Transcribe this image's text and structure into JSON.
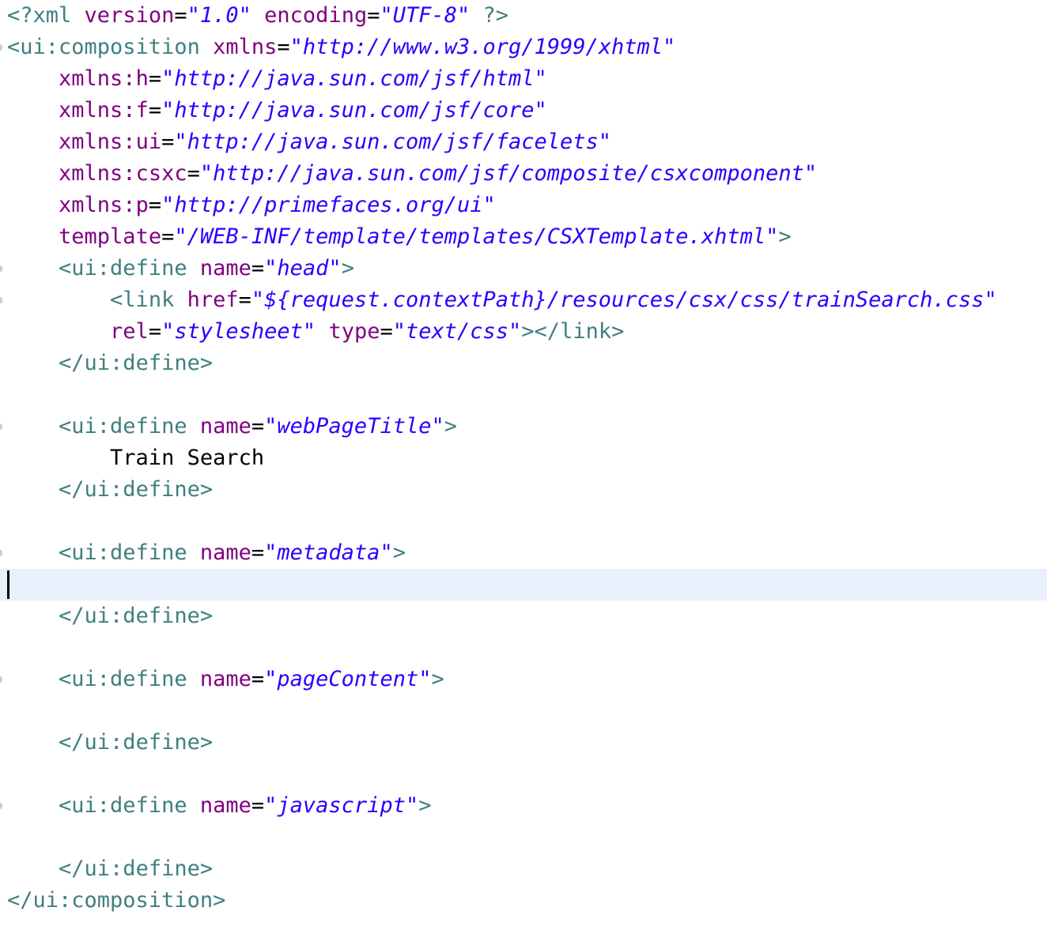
{
  "editor": {
    "lines": [
      {
        "tokens": [
          {
            "cls": "pi",
            "text": "<?xml "
          },
          {
            "cls": "attr",
            "text": "version"
          },
          {
            "cls": "text",
            "text": "="
          },
          {
            "cls": "val",
            "text": "\"1.0\""
          },
          {
            "cls": "text",
            "text": " "
          },
          {
            "cls": "attr",
            "text": "encoding"
          },
          {
            "cls": "text",
            "text": "="
          },
          {
            "cls": "val",
            "text": "\"UTF-8\""
          },
          {
            "cls": "pi",
            "text": " ?>"
          }
        ]
      },
      {
        "fold": true,
        "tokens": [
          {
            "cls": "tag",
            "text": "<ui:composition "
          },
          {
            "cls": "attr",
            "text": "xmlns"
          },
          {
            "cls": "text",
            "text": "="
          },
          {
            "cls": "val",
            "text": "\"http://www.w3.org/1999/xhtml\""
          }
        ]
      },
      {
        "tokens": [
          {
            "cls": "text",
            "text": "    "
          },
          {
            "cls": "attr",
            "text": "xmlns:h"
          },
          {
            "cls": "text",
            "text": "="
          },
          {
            "cls": "val",
            "text": "\"http://java.sun.com/jsf/html\""
          }
        ]
      },
      {
        "tokens": [
          {
            "cls": "text",
            "text": "    "
          },
          {
            "cls": "attr",
            "text": "xmlns:f"
          },
          {
            "cls": "text",
            "text": "="
          },
          {
            "cls": "val",
            "text": "\"http://java.sun.com/jsf/core\""
          }
        ]
      },
      {
        "tokens": [
          {
            "cls": "text",
            "text": "    "
          },
          {
            "cls": "attr",
            "text": "xmlns:ui"
          },
          {
            "cls": "text",
            "text": "="
          },
          {
            "cls": "val",
            "text": "\"http://java.sun.com/jsf/facelets\""
          }
        ]
      },
      {
        "tokens": [
          {
            "cls": "text",
            "text": "    "
          },
          {
            "cls": "attr",
            "text": "xmlns:csxc"
          },
          {
            "cls": "text",
            "text": "="
          },
          {
            "cls": "val",
            "text": "\"http://java.sun.com/jsf/composite/csxcomponent\""
          }
        ]
      },
      {
        "tokens": [
          {
            "cls": "text",
            "text": "    "
          },
          {
            "cls": "attr",
            "text": "xmlns:p"
          },
          {
            "cls": "text",
            "text": "="
          },
          {
            "cls": "val",
            "text": "\"http://primefaces.org/ui\""
          }
        ]
      },
      {
        "tokens": [
          {
            "cls": "text",
            "text": "    "
          },
          {
            "cls": "attr",
            "text": "template"
          },
          {
            "cls": "text",
            "text": "="
          },
          {
            "cls": "val",
            "text": "\"/WEB-INF/template/templates/CSXTemplate.xhtml\""
          },
          {
            "cls": "tag",
            "text": ">"
          }
        ]
      },
      {
        "fold": true,
        "tokens": [
          {
            "cls": "text",
            "text": "    "
          },
          {
            "cls": "tag",
            "text": "<ui:define "
          },
          {
            "cls": "attr",
            "text": "name"
          },
          {
            "cls": "text",
            "text": "="
          },
          {
            "cls": "val",
            "text": "\"head\""
          },
          {
            "cls": "tag",
            "text": ">"
          }
        ]
      },
      {
        "fold": true,
        "tokens": [
          {
            "cls": "text",
            "text": "        "
          },
          {
            "cls": "tag",
            "text": "<link "
          },
          {
            "cls": "attr",
            "text": "href"
          },
          {
            "cls": "text",
            "text": "="
          },
          {
            "cls": "val",
            "text": "\"${request.contextPath}/resources/csx/css/trainSearch.css\""
          }
        ]
      },
      {
        "tokens": [
          {
            "cls": "text",
            "text": "        "
          },
          {
            "cls": "attr",
            "text": "rel"
          },
          {
            "cls": "text",
            "text": "="
          },
          {
            "cls": "val",
            "text": "\"stylesheet\""
          },
          {
            "cls": "text",
            "text": " "
          },
          {
            "cls": "attr",
            "text": "type"
          },
          {
            "cls": "text",
            "text": "="
          },
          {
            "cls": "val",
            "text": "\"text/css\""
          },
          {
            "cls": "tag",
            "text": "></link>"
          }
        ]
      },
      {
        "tokens": [
          {
            "cls": "text",
            "text": "    "
          },
          {
            "cls": "tag",
            "text": "</ui:define>"
          }
        ]
      },
      {
        "tokens": []
      },
      {
        "fold": true,
        "tokens": [
          {
            "cls": "text",
            "text": "    "
          },
          {
            "cls": "tag",
            "text": "<ui:define "
          },
          {
            "cls": "attr",
            "text": "name"
          },
          {
            "cls": "text",
            "text": "="
          },
          {
            "cls": "val",
            "text": "\"webPageTitle\""
          },
          {
            "cls": "tag",
            "text": ">"
          }
        ]
      },
      {
        "tokens": [
          {
            "cls": "text",
            "text": "        Train Search"
          }
        ]
      },
      {
        "tokens": [
          {
            "cls": "text",
            "text": "    "
          },
          {
            "cls": "tag",
            "text": "</ui:define>"
          }
        ]
      },
      {
        "tokens": []
      },
      {
        "fold": true,
        "tokens": [
          {
            "cls": "text",
            "text": "    "
          },
          {
            "cls": "tag",
            "text": "<ui:define "
          },
          {
            "cls": "attr",
            "text": "name"
          },
          {
            "cls": "text",
            "text": "="
          },
          {
            "cls": "val",
            "text": "\"metadata\""
          },
          {
            "cls": "tag",
            "text": ">"
          }
        ]
      },
      {
        "current": true,
        "tokens": []
      },
      {
        "tokens": [
          {
            "cls": "text",
            "text": "    "
          },
          {
            "cls": "tag",
            "text": "</ui:define>"
          }
        ]
      },
      {
        "tokens": []
      },
      {
        "fold": true,
        "tokens": [
          {
            "cls": "text",
            "text": "    "
          },
          {
            "cls": "tag",
            "text": "<ui:define "
          },
          {
            "cls": "attr",
            "text": "name"
          },
          {
            "cls": "text",
            "text": "="
          },
          {
            "cls": "val",
            "text": "\"pageContent\""
          },
          {
            "cls": "tag",
            "text": ">"
          }
        ]
      },
      {
        "tokens": []
      },
      {
        "tokens": [
          {
            "cls": "text",
            "text": "    "
          },
          {
            "cls": "tag",
            "text": "</ui:define>"
          }
        ]
      },
      {
        "tokens": []
      },
      {
        "fold": true,
        "tokens": [
          {
            "cls": "text",
            "text": "    "
          },
          {
            "cls": "tag",
            "text": "<ui:define "
          },
          {
            "cls": "attr",
            "text": "name"
          },
          {
            "cls": "text",
            "text": "="
          },
          {
            "cls": "val",
            "text": "\"javascript\""
          },
          {
            "cls": "tag",
            "text": ">"
          }
        ]
      },
      {
        "tokens": []
      },
      {
        "tokens": [
          {
            "cls": "text",
            "text": "    "
          },
          {
            "cls": "tag",
            "text": "</ui:define>"
          }
        ]
      },
      {
        "tokens": [
          {
            "cls": "tag",
            "text": "</ui:composition>"
          }
        ]
      }
    ]
  }
}
